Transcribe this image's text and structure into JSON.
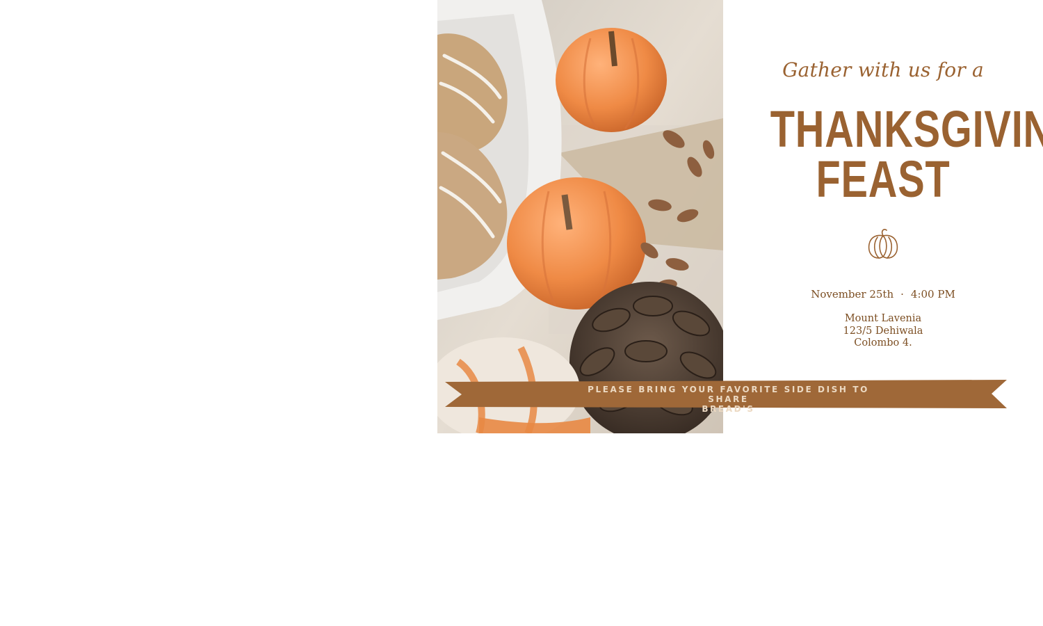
{
  "invitation": {
    "intro": "Gather with us for a",
    "title_lines": [
      "THANKSGIVING",
      "FEAST"
    ],
    "date": "November 25th",
    "separator": "·",
    "time": "4:00 PM",
    "address_lines": [
      "Mount Lavenia",
      "123/5 Dehiwala",
      "Colombo 4."
    ],
    "ribbon_lines": [
      "PLEASE BRING YOUR FAVORITE SIDE DISH TO SHARE",
      "BREAD'S"
    ]
  },
  "colors": {
    "accent": "#9a6231",
    "ribbon": "#9f6838",
    "ribbon_text": "#ecd9c2",
    "pumpkin": "#ef8a45"
  },
  "icons": {
    "divider": "pumpkin-outline-icon"
  }
}
